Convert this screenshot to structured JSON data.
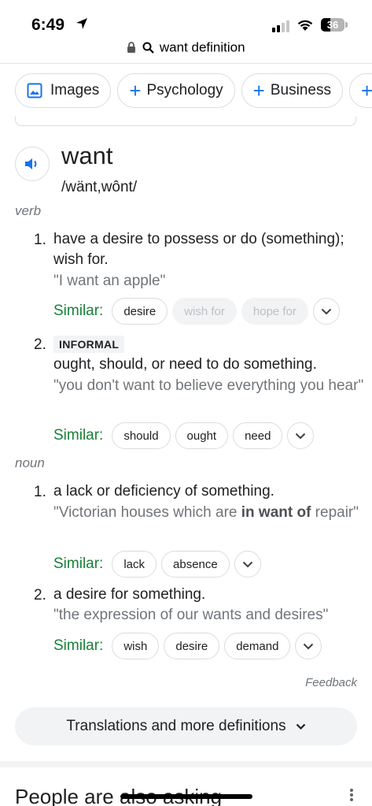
{
  "status_bar": {
    "time": "6:49",
    "battery": "36",
    "icons": [
      "location-arrow-icon",
      "signal-icon",
      "wifi-icon",
      "battery-icon"
    ]
  },
  "url_bar": {
    "query": "want definition",
    "icons": [
      "lock-icon",
      "search-icon"
    ]
  },
  "chips": [
    {
      "label": "Images",
      "icon": "image-icon"
    },
    {
      "label": "Psychology",
      "icon": "plus-icon"
    },
    {
      "label": "Business",
      "icon": "plus-icon"
    }
  ],
  "entry": {
    "word": "want",
    "pronunciation": "/wänt,wônt/",
    "verb": {
      "label": "verb",
      "senses": [
        {
          "number": "1.",
          "definition": "have a desire to possess or do (something); wish for.",
          "example": "\"I want an apple\"",
          "similar_label": "Similar:",
          "similar": [
            "desire",
            "wish for",
            "hope for"
          ]
        },
        {
          "number": "2.",
          "tag": "INFORMAL",
          "definition": "ought, should, or need to do something.",
          "example": "\"you don't want to believe everything you hear\"",
          "similar_label": "Similar:",
          "similar": [
            "should",
            "ought",
            "need"
          ]
        }
      ]
    },
    "noun": {
      "label": "noun",
      "senses": [
        {
          "number": "1.",
          "definition": "a lack or deficiency of something.",
          "example_before": "\"Victorian houses which are ",
          "example_bold": "in want of",
          "example_after": " repair\"",
          "similar_label": "Similar:",
          "similar": [
            "lack",
            "absence"
          ]
        },
        {
          "number": "2.",
          "definition": "a desire for something.",
          "example": "\"the expression of our wants and desires\"",
          "similar_label": "Similar:",
          "similar": [
            "wish",
            "desire",
            "demand"
          ]
        }
      ]
    }
  },
  "feedback_label": "Feedback",
  "translations_button": "Translations and more definitions",
  "people_also_ask": "People are also asking",
  "colors": {
    "accent_blue": "#1a73e8",
    "similar_green": "#188038",
    "muted_gray": "#70757a"
  }
}
